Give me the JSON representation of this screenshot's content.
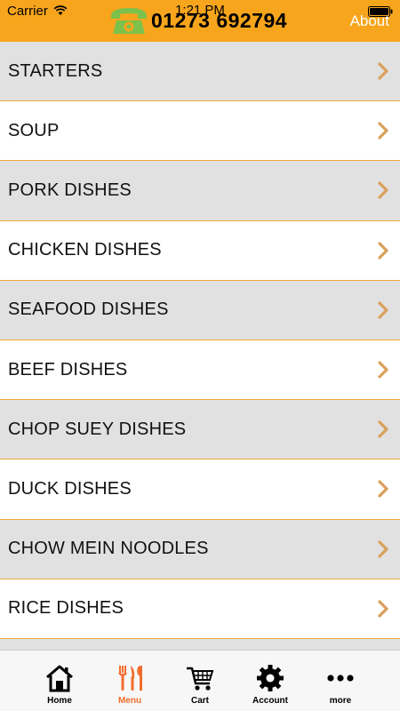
{
  "status_bar": {
    "carrier": "Carrier",
    "time": "1:21 PM"
  },
  "header": {
    "phone_number": "01273 692794",
    "about_label": "About",
    "icon": "phone-icon"
  },
  "colors": {
    "accent": "#f7a51c",
    "row_alt": "#e1e1e1",
    "chevron": "#d9a05b",
    "active_tab": "#f26c2c"
  },
  "menu": {
    "items": [
      {
        "label": "STARTERS"
      },
      {
        "label": "SOUP"
      },
      {
        "label": "PORK DISHES"
      },
      {
        "label": "CHICKEN DISHES"
      },
      {
        "label": "SEAFOOD DISHES"
      },
      {
        "label": "BEEF DISHES"
      },
      {
        "label": "CHOP SUEY DISHES"
      },
      {
        "label": "DUCK DISHES"
      },
      {
        "label": "CHOW MEIN NOODLES"
      },
      {
        "label": "RICE DISHES"
      }
    ]
  },
  "tabbar": {
    "tabs": [
      {
        "label": "Home",
        "icon": "home-icon"
      },
      {
        "label": "Menu",
        "icon": "fork-knife-icon",
        "active": true
      },
      {
        "label": "Cart",
        "icon": "cart-icon"
      },
      {
        "label": "Account",
        "icon": "gear-icon"
      },
      {
        "label": "more",
        "icon": "more-icon"
      }
    ]
  }
}
